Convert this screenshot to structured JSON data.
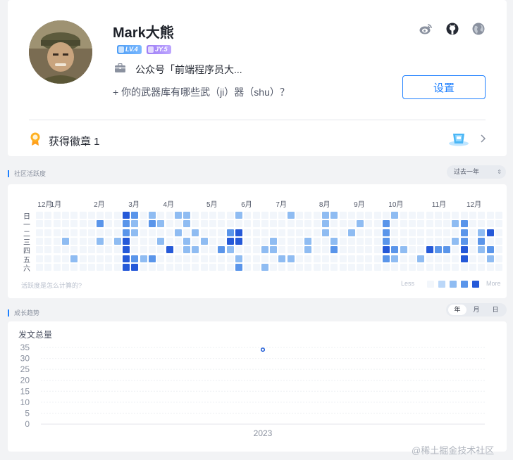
{
  "profile": {
    "username": "Mark大熊",
    "level_badge": "LV.4",
    "jy_badge": "JY.5",
    "job": "公众号「前端程序员大...",
    "motto": "+ 你的武器库有哪些武（ji）器（shu）？",
    "settings_label": "设置",
    "medal_label": "获得徽章 1",
    "icons": [
      "weibo-icon",
      "github-icon",
      "globe-icon"
    ]
  },
  "activity": {
    "title": "社区活跃度",
    "range": "过去一年",
    "months": [
      {
        "label": "12月",
        "week": 1
      },
      {
        "label": "1月",
        "week": 2
      },
      {
        "label": "2月",
        "week": 7
      },
      {
        "label": "3月",
        "week": 11
      },
      {
        "label": "4月",
        "week": 15
      },
      {
        "label": "5月",
        "week": 20
      },
      {
        "label": "6月",
        "week": 24
      },
      {
        "label": "7月",
        "week": 28
      },
      {
        "label": "8月",
        "week": 33
      },
      {
        "label": "9月",
        "week": 37
      },
      {
        "label": "10月",
        "week": 41
      },
      {
        "label": "11月",
        "week": 46
      },
      {
        "label": "12月",
        "week": 50
      }
    ],
    "days": [
      "日",
      "一",
      "二",
      "三",
      "四",
      "五",
      "六"
    ],
    "hint": "活跃度是怎么计算的?",
    "legend_less": "Less",
    "legend_more": "More",
    "colors": [
      "#f2f6fb",
      "#bbd7f8",
      "#8fbcf2",
      "#5a95ea",
      "#2559d8"
    ],
    "levels": [
      [
        0,
        0,
        0,
        0,
        0,
        0,
        0
      ],
      [
        0,
        0,
        0,
        0,
        0,
        0,
        0
      ],
      [
        0,
        0,
        0,
        0,
        0,
        0,
        0
      ],
      [
        0,
        0,
        0,
        2,
        0,
        0,
        0
      ],
      [
        0,
        0,
        0,
        0,
        0,
        2,
        0
      ],
      [
        0,
        0,
        0,
        0,
        0,
        0,
        0
      ],
      [
        0,
        0,
        0,
        0,
        0,
        0,
        0
      ],
      [
        0,
        3,
        0,
        2,
        0,
        0,
        0
      ],
      [
        0,
        0,
        0,
        0,
        0,
        0,
        0
      ],
      [
        0,
        0,
        0,
        2,
        0,
        0,
        0
      ],
      [
        4,
        3,
        3,
        4,
        4,
        4,
        4
      ],
      [
        3,
        2,
        2,
        0,
        0,
        3,
        4
      ],
      [
        0,
        0,
        0,
        0,
        0,
        2,
        0
      ],
      [
        2,
        3,
        0,
        0,
        0,
        3,
        0
      ],
      [
        0,
        2,
        0,
        2,
        0,
        0,
        0
      ],
      [
        0,
        0,
        0,
        0,
        4,
        0,
        0
      ],
      [
        2,
        0,
        2,
        0,
        0,
        0,
        0
      ],
      [
        2,
        2,
        0,
        2,
        2,
        0,
        0
      ],
      [
        0,
        0,
        2,
        0,
        2,
        0,
        0
      ],
      [
        0,
        0,
        0,
        2,
        0,
        0,
        0
      ],
      [
        0,
        0,
        0,
        0,
        0,
        0,
        0
      ],
      [
        0,
        0,
        0,
        0,
        3,
        0,
        0
      ],
      [
        0,
        0,
        3,
        4,
        2,
        0,
        0
      ],
      [
        2,
        0,
        4,
        4,
        0,
        2,
        3
      ],
      [
        0,
        0,
        0,
        0,
        0,
        0,
        0
      ],
      [
        0,
        0,
        0,
        0,
        0,
        0,
        0
      ],
      [
        0,
        0,
        0,
        0,
        2,
        0,
        2
      ],
      [
        0,
        0,
        0,
        2,
        2,
        0,
        0
      ],
      [
        0,
        0,
        0,
        0,
        0,
        2,
        0
      ],
      [
        2,
        0,
        0,
        0,
        0,
        2,
        0
      ],
      [
        0,
        0,
        0,
        0,
        0,
        0,
        0
      ],
      [
        0,
        0,
        0,
        2,
        2,
        0,
        0
      ],
      [
        0,
        0,
        0,
        0,
        0,
        0,
        0
      ],
      [
        2,
        2,
        2,
        0,
        0,
        0,
        0
      ],
      [
        2,
        0,
        0,
        2,
        3,
        0,
        0
      ],
      [
        0,
        0,
        0,
        0,
        0,
        0,
        0
      ],
      [
        0,
        0,
        2,
        0,
        0,
        0,
        0
      ],
      [
        0,
        2,
        0,
        0,
        0,
        0,
        0
      ],
      [
        0,
        0,
        0,
        0,
        0,
        0,
        0
      ],
      [
        0,
        0,
        0,
        0,
        0,
        0,
        0
      ],
      [
        0,
        3,
        3,
        3,
        4,
        3,
        0
      ],
      [
        2,
        0,
        0,
        0,
        3,
        2,
        0
      ],
      [
        0,
        0,
        0,
        0,
        2,
        0,
        0
      ],
      [
        0,
        0,
        0,
        0,
        0,
        0,
        0
      ],
      [
        0,
        0,
        0,
        0,
        0,
        2,
        0
      ],
      [
        0,
        0,
        0,
        0,
        4,
        0,
        0
      ],
      [
        0,
        0,
        0,
        0,
        3,
        0,
        0
      ],
      [
        0,
        0,
        0,
        0,
        3,
        0,
        0
      ],
      [
        0,
        2,
        0,
        2,
        0,
        0,
        0
      ],
      [
        0,
        3,
        3,
        3,
        4,
        4,
        0
      ],
      [
        0,
        0,
        0,
        0,
        0,
        0,
        0
      ],
      [
        0,
        0,
        2,
        3,
        2,
        0,
        0
      ],
      [
        0,
        0,
        4,
        0,
        3,
        2,
        0
      ],
      [
        0,
        0,
        0,
        0,
        0,
        0,
        0
      ]
    ]
  },
  "growth": {
    "title": "成长趋势",
    "toggle": [
      "年",
      "月",
      "日"
    ],
    "active": "年"
  },
  "chart_data": {
    "type": "scatter",
    "title": "发文总量",
    "categories": [
      "2023"
    ],
    "series": [
      {
        "values": [
          34
        ]
      }
    ],
    "ylim": [
      0,
      35
    ],
    "yticks": [
      0,
      5,
      10,
      15,
      20,
      25,
      30,
      35
    ],
    "grid": true
  },
  "watermark": "@稀土掘金技术社区"
}
